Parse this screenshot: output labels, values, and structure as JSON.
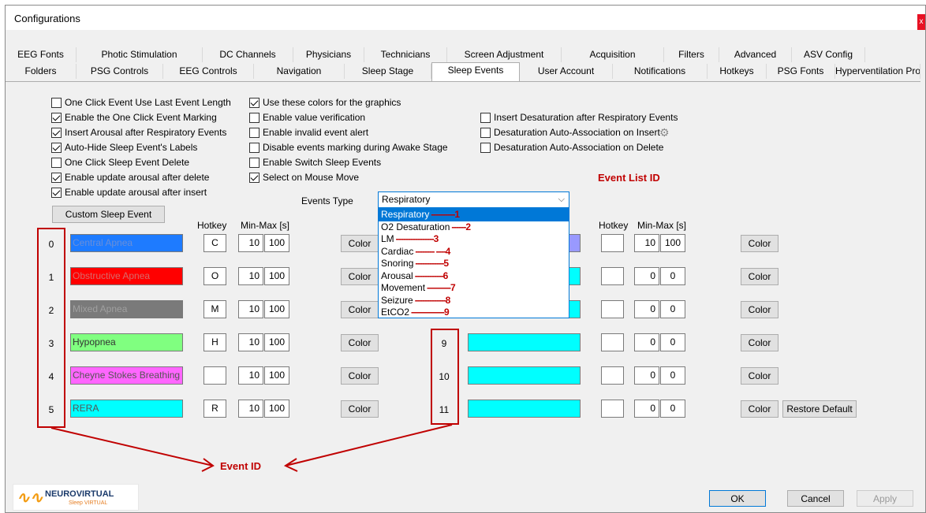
{
  "window": {
    "title": "Configurations",
    "close": "x"
  },
  "tabs_row1": [
    "EEG Fonts",
    "Photic Stimulation",
    "DC Channels",
    "Physicians",
    "Technicians",
    "Screen Adjustment",
    "Acquisition",
    "Filters",
    "Advanced",
    "ASV Config"
  ],
  "tabs_row2": [
    "Folders",
    "PSG Controls",
    "EEG Controls",
    "Navigation",
    "Sleep Stage",
    "Sleep Events",
    "User Account",
    "Notifications",
    "Hotkeys",
    "PSG Fonts",
    "Hyperventilation Protocol"
  ],
  "selected_tab": "Sleep Events",
  "checkboxes_col1": [
    {
      "label": "One Click Event Use Last Event Length",
      "checked": false
    },
    {
      "label": "Enable the One Click Event Marking",
      "checked": true
    },
    {
      "label": "Insert Arousal after Respiratory Events",
      "checked": true
    },
    {
      "label": "Auto-Hide Sleep Event's Labels",
      "checked": true
    },
    {
      "label": "One Click Sleep Event Delete",
      "checked": false
    },
    {
      "label": "Enable update arousal after delete",
      "checked": true
    },
    {
      "label": "Enable update arousal after insert",
      "checked": true
    }
  ],
  "checkboxes_col2": [
    {
      "label": "Use these colors for the graphics",
      "checked": true
    },
    {
      "label": "Enable value verification",
      "checked": false
    },
    {
      "label": "Enable invalid event alert",
      "checked": false
    },
    {
      "label": "Disable events marking during Awake Stage",
      "checked": false
    },
    {
      "label": "Enable Switch Sleep Events",
      "checked": false
    },
    {
      "label": "Select on Mouse Move",
      "checked": true
    }
  ],
  "checkboxes_col3": [
    {
      "label": "Insert Desaturation after Respiratory Events",
      "checked": false
    },
    {
      "label": "Desaturation Auto-Association on Insert",
      "checked": false
    },
    {
      "label": "Desaturation Auto-Association on Delete",
      "checked": false
    }
  ],
  "custom_sleep_event": "Custom Sleep Event",
  "events_type_label": "Events Type",
  "events_type_value": "Respiratory",
  "hotkey_header": "Hotkey",
  "minmax_header": "Min-Max [s]",
  "color_button": "Color",
  "restore_default": "Restore Default",
  "dropdown_items": [
    {
      "label": "Respiratory",
      "dashes": "----------",
      "id": "1"
    },
    {
      "label": "O2 Desaturation",
      "dashes": "------",
      "id": "2"
    },
    {
      "label": "LM",
      "dashes": " ----------------",
      "id": "3"
    },
    {
      "label": "Cardiac",
      "dashes": " -------- ----",
      "id": "4"
    },
    {
      "label": "Snoring",
      "dashes": " ------------",
      "id": "5"
    },
    {
      "label": "Arousal",
      "dashes": " ------------",
      "id": "6"
    },
    {
      "label": "Movement",
      "dashes": " ----------",
      "id": "7"
    },
    {
      "label": "Seizure",
      "dashes": " -------------",
      "id": "8"
    },
    {
      "label": "EtCO2",
      "dashes": " --------------",
      "id": "9"
    }
  ],
  "left_events": [
    {
      "id": "0",
      "name": "Central Apnea",
      "color": "#1e7bff",
      "text_color": "#6a8fd8",
      "hotkey": "C",
      "min": "10",
      "max": "100"
    },
    {
      "id": "1",
      "name": "Obstructive Apnea",
      "color": "#ff0000",
      "text_color": "#d86a6a",
      "hotkey": "O",
      "min": "10",
      "max": "100"
    },
    {
      "id": "2",
      "name": "Mixed Apnea",
      "color": "#7a7a7a",
      "text_color": "#a0a0a0",
      "hotkey": "M",
      "min": "10",
      "max": "100"
    },
    {
      "id": "3",
      "name": "Hypopnea",
      "color": "#80ff80",
      "text_color": "#333333",
      "hotkey": "H",
      "min": "10",
      "max": "100"
    },
    {
      "id": "4",
      "name": "Cheyne Stokes Breathing",
      "color": "#ff66ff",
      "text_color": "#555555",
      "hotkey": "",
      "min": "10",
      "max": "100"
    },
    {
      "id": "5",
      "name": "RERA",
      "color": "#00ffff",
      "text_color": "#555555",
      "hotkey": "R",
      "min": "10",
      "max": "100"
    }
  ],
  "right_events": [
    {
      "id": "",
      "color": "#9999ff",
      "hotkey": "",
      "min": "10",
      "max": "100"
    },
    {
      "id": "",
      "color": "#00ffff",
      "hotkey": "",
      "min": "0",
      "max": "0"
    },
    {
      "id": "",
      "color": "#00ffff",
      "hotkey": "",
      "min": "0",
      "max": "0"
    },
    {
      "id": "9",
      "color": "#00ffff",
      "hotkey": "",
      "min": "0",
      "max": "0"
    },
    {
      "id": "10",
      "color": "#00ffff",
      "hotkey": "",
      "min": "0",
      "max": "0"
    },
    {
      "id": "11",
      "color": "#00ffff",
      "hotkey": "",
      "min": "0",
      "max": "0"
    }
  ],
  "annotations": {
    "event_list_id": "Event List ID",
    "event_id": "Event ID"
  },
  "footer": {
    "ok": "OK",
    "cancel": "Cancel",
    "apply": "Apply",
    "logo_main": "NEUROVIRTUAL",
    "logo_sub": "Sleep VIRTUAL"
  }
}
